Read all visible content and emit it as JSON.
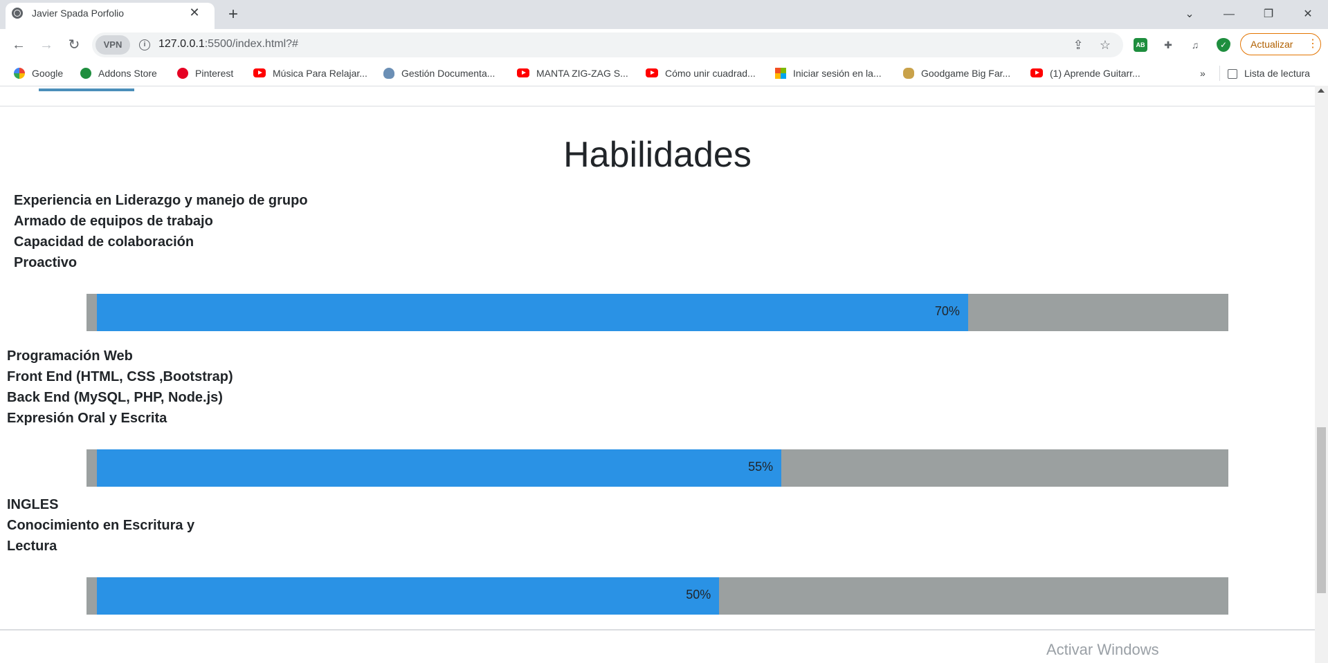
{
  "browser": {
    "tab_title": "Javier Spada Porfolio",
    "tab_close": "✕",
    "new_tab": "+",
    "url_host": "127.0.0.1",
    "url_rest": ":5500/index.html?#",
    "vpn_label": "VPN",
    "update_label": "Actualizar",
    "reading_list": "Lista de lectura",
    "more_bookmarks": "»",
    "bookmarks": [
      {
        "label": "Google",
        "icon": "google-icon"
      },
      {
        "label": "Addons Store",
        "icon": "addons-icon"
      },
      {
        "label": "Pinterest",
        "icon": "pinterest-icon"
      },
      {
        "label": "Música Para Relajar...",
        "icon": "youtube-icon"
      },
      {
        "label": "Gestión Documenta...",
        "icon": "crest-icon"
      },
      {
        "label": "MANTA ZIG-ZAG S...",
        "icon": "youtube-icon"
      },
      {
        "label": "Cómo unir cuadrad...",
        "icon": "youtube-icon"
      },
      {
        "label": "Iniciar sesión en la...",
        "icon": "microsoft-icon"
      },
      {
        "label": "Goodgame Big Far...",
        "icon": "goodgame-icon"
      },
      {
        "label": "(1) Aprende Guitarr...",
        "icon": "youtube-icon"
      }
    ]
  },
  "page": {
    "heading": "Habilidades",
    "sections": [
      {
        "lines": [
          "Experiencia en Liderazgo y manejo de grupo",
          "Armado de equipos de trabajo",
          "Capacidad de colaboración",
          "Proactivo"
        ],
        "percent_label": "70%",
        "percent": 70
      },
      {
        "lines": [
          "Programación Web",
          "Front End (HTML, CSS ,Bootstrap)",
          "Back End (MySQL, PHP, Node.js)",
          "Expresión Oral y Escrita"
        ],
        "percent_label": "55%",
        "percent": 55
      },
      {
        "lines": [
          "INGLES",
          "Conocimiento en Escritura y",
          "Lectura"
        ],
        "percent_label": "50%",
        "percent": 50
      }
    ],
    "watermark": "Activar Windows"
  },
  "colors": {
    "bar_fill": "#2a92e5",
    "bar_track": "#9ba0a0"
  }
}
